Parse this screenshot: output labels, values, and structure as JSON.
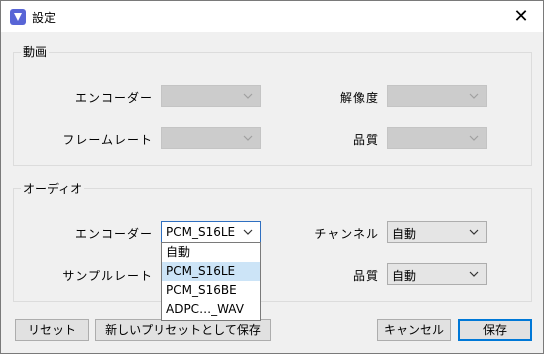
{
  "window": {
    "title": "設定",
    "close_glyph": "✕"
  },
  "video": {
    "group_label": "動画",
    "encoder_label": "エンコーダー",
    "encoder_value": "",
    "resolution_label": "解像度",
    "resolution_value": "",
    "framerate_label": "フレームレート",
    "framerate_value": "",
    "quality_label": "品質",
    "quality_value": ""
  },
  "audio": {
    "group_label": "オーディオ",
    "encoder_label": "エンコーダー",
    "encoder_value": "PCM_S16LE",
    "channel_label": "チャンネル",
    "channel_value": "自動",
    "samplerate_label": "サンプルレート",
    "quality_label": "品質",
    "quality_value": "自動",
    "encoder_options": [
      "自動",
      "PCM_S16LE",
      "PCM_S16BE",
      "ADPC…_WAV"
    ],
    "encoder_selected_index": 1
  },
  "buttons": {
    "reset": "リセット",
    "save_new_preset": "新しいプリセットとして保存",
    "cancel": "キャンセル",
    "save": "保存"
  },
  "colors": {
    "accent": "#0078d7",
    "dropdown_highlight": "#cce4f7",
    "app_icon": "#5865d6"
  }
}
